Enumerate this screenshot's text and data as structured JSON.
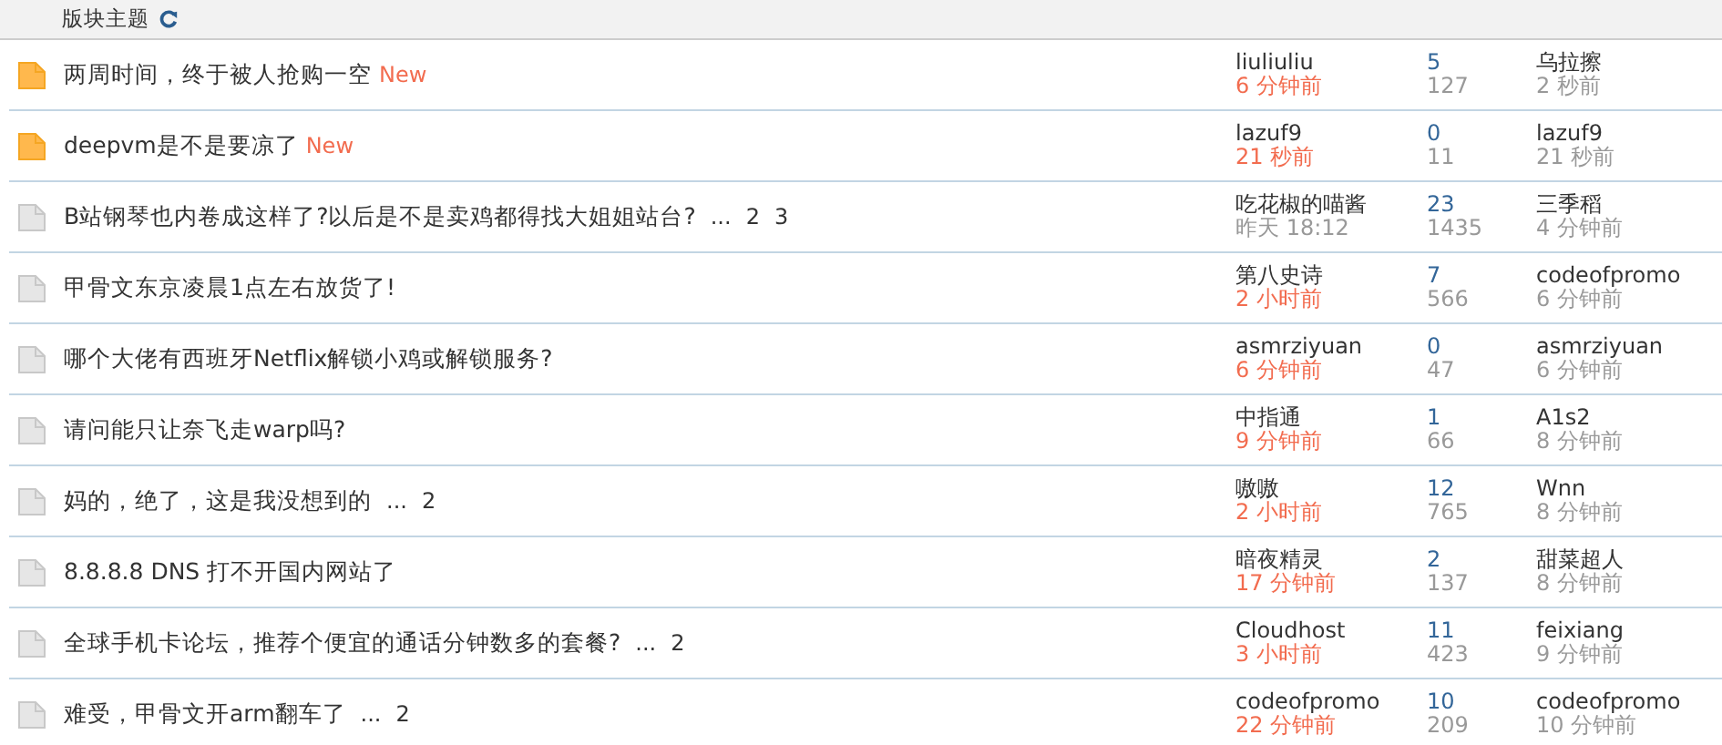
{
  "header": {
    "title": "版块主题"
  },
  "threads": [
    {
      "unread": true,
      "title": "两周时间，终于被人抢购一空",
      "badge": "New",
      "author": "liuliuliu",
      "posted": "6 分钟前",
      "recent": true,
      "replies": "5",
      "views": "127",
      "last_user": "乌拉擦",
      "last_time": "2 秒前"
    },
    {
      "unread": true,
      "title": "deepvm是不是要凉了",
      "badge": "New",
      "author": "lazuf9",
      "posted": "21 秒前",
      "recent": true,
      "replies": "0",
      "views": "11",
      "last_user": "lazuf9",
      "last_time": "21 秒前"
    },
    {
      "unread": false,
      "title": "B站钢琴也内卷成这样了?以后是不是卖鸡都得找大姐姐站台?",
      "pages_ellipsis": "...",
      "pages": [
        "2",
        "3"
      ],
      "author": "吃花椒的喵酱",
      "posted": "昨天 18:12",
      "recent": false,
      "replies": "23",
      "views": "1435",
      "last_user": "三季稻",
      "last_time": "4 分钟前"
    },
    {
      "unread": false,
      "title": "甲骨文东京凌晨1点左右放货了!",
      "author": "第八史诗",
      "posted": "2 小时前",
      "recent": true,
      "replies": "7",
      "views": "566",
      "last_user": "codeofpromo",
      "last_time": "6 分钟前"
    },
    {
      "unread": false,
      "title": "哪个大佬有西班牙Netflix解锁小鸡或解锁服务?",
      "author": "asmrziyuan",
      "posted": "6 分钟前",
      "recent": true,
      "replies": "0",
      "views": "47",
      "last_user": "asmrziyuan",
      "last_time": "6 分钟前"
    },
    {
      "unread": false,
      "title": "请问能只让奈飞走warp吗?",
      "author": "中指通",
      "posted": "9 分钟前",
      "recent": true,
      "replies": "1",
      "views": "66",
      "last_user": "A1s2",
      "last_time": "8 分钟前"
    },
    {
      "unread": false,
      "title": "妈的，绝了，这是我没想到的",
      "pages_ellipsis": "...",
      "pages": [
        "2"
      ],
      "author": "嗷嗷",
      "posted": "2 小时前",
      "recent": true,
      "replies": "12",
      "views": "765",
      "last_user": "Wnn",
      "last_time": "8 分钟前"
    },
    {
      "unread": false,
      "title": "8.8.8.8 DNS 打不开国内网站了",
      "author": "暗夜精灵",
      "posted": "17 分钟前",
      "recent": true,
      "replies": "2",
      "views": "137",
      "last_user": "甜菜超人",
      "last_time": "8 分钟前"
    },
    {
      "unread": false,
      "title": "全球手机卡论坛，推荐个便宜的通话分钟数多的套餐?",
      "pages_ellipsis": "...",
      "pages": [
        "2"
      ],
      "author": "Cloudhost",
      "posted": "3 小时前",
      "recent": true,
      "replies": "11",
      "views": "423",
      "last_user": "feixiang",
      "last_time": "9 分钟前"
    },
    {
      "unread": false,
      "title": "难受，甲骨文开arm翻车了",
      "pages_ellipsis": "...",
      "pages": [
        "2"
      ],
      "author": "codeofpromo",
      "posted": "22 分钟前",
      "recent": true,
      "replies": "10",
      "views": "209",
      "last_user": "codeofpromo",
      "last_time": "10 分钟前"
    }
  ]
}
